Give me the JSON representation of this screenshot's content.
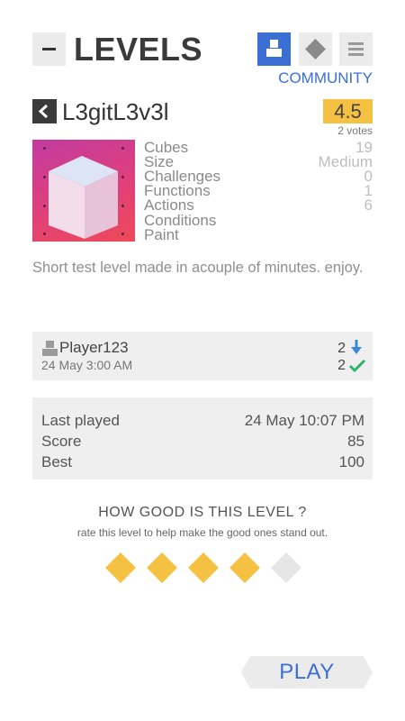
{
  "header": {
    "title": "LEVELS",
    "tab_active_label": "COMMUNITY"
  },
  "level": {
    "name": "L3gitL3v3l",
    "rating": "4.5",
    "votes": "2 votes",
    "description": "Short test level made in  acouple of minutes. enjoy."
  },
  "stats": [
    {
      "label": "Cubes",
      "value": "19"
    },
    {
      "label": "Size",
      "value": "Medium"
    },
    {
      "label": "Challenges",
      "value": "0"
    },
    {
      "label": "Functions",
      "value": "1"
    },
    {
      "label": "Actions",
      "value": "6"
    },
    {
      "label": "Conditions",
      "value": ""
    },
    {
      "label": "Paint",
      "value": ""
    }
  ],
  "author": {
    "name": "Player123",
    "date": "24 May 3:00 AM",
    "downloads": "2",
    "completions": "2"
  },
  "play_stats": {
    "last_played_label": "Last played",
    "last_played_value": "24 May 10:07 PM",
    "score_label": "Score",
    "score_value": "85",
    "best_label": "Best",
    "best_value": "100"
  },
  "rating_prompt": {
    "title": "HOW GOOD IS THIS LEVEL ?",
    "subtitle": "rate this level to help make the good ones stand out.",
    "user_stars": 4,
    "max_stars": 5
  },
  "play_button": {
    "label": "PLAY"
  },
  "colors": {
    "accent": "#3b6fd4",
    "rating_bg": "#f5c142",
    "star_on": "#f5c142",
    "star_off": "#e6e6e6",
    "check": "#2db36a"
  }
}
